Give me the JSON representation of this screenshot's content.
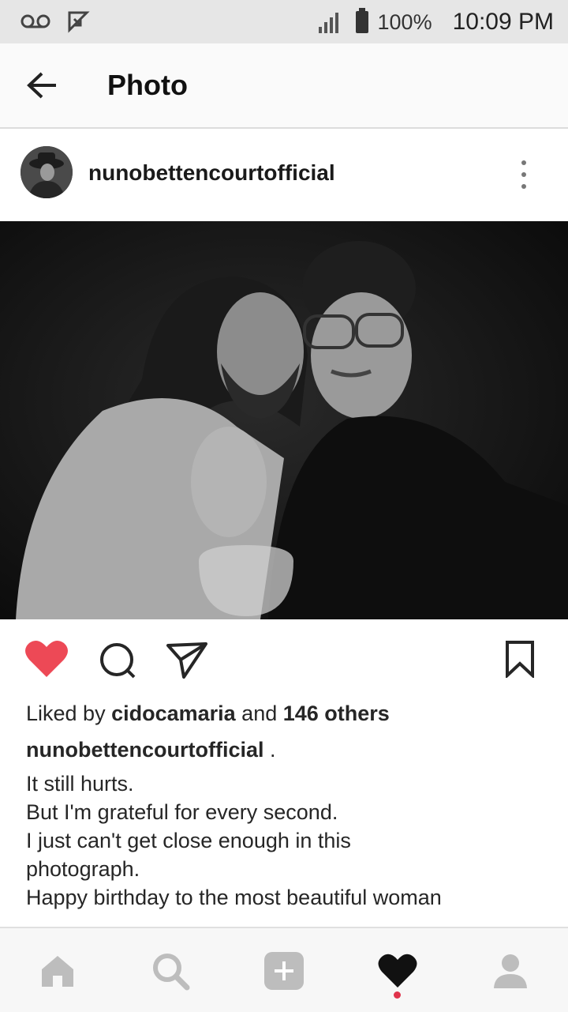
{
  "status_bar": {
    "battery_percent": "100%",
    "time": "10:09 PM",
    "icons": [
      "voicemail-icon",
      "missed-call-icon",
      "signal-icon",
      "battery-icon"
    ]
  },
  "header": {
    "title": "Photo",
    "back_icon": "arrow-left-icon"
  },
  "post": {
    "username": "nunobettencourtofficial",
    "more_icon": "more-vertical-icon",
    "photo_icon": "photo",
    "liked": true,
    "actions": [
      "heart-icon",
      "comment-icon",
      "share-icon",
      "bookmark-icon"
    ],
    "likes": {
      "prefix": "Liked by ",
      "user": "cidocamaria",
      "middle": " and ",
      "others": "146 others"
    },
    "caption": {
      "user": "nunobettencourtofficial",
      "after_user": " .",
      "lines": [
        "It still hurts.",
        "But I'm grateful for every second.",
        "I just can't get close enough in this",
        "photograph.",
        "Happy birthday to the most beautiful woman"
      ]
    }
  },
  "bottom_nav": {
    "items": [
      "home-icon",
      "search-icon",
      "add-post-icon",
      "activity-heart-icon",
      "profile-icon"
    ],
    "active": "activity-heart-icon",
    "accent_color": "#e0344c"
  },
  "colors": {
    "like_red": "#ed4956",
    "text": "#262626",
    "nav_icon": "#bdbdbd"
  }
}
